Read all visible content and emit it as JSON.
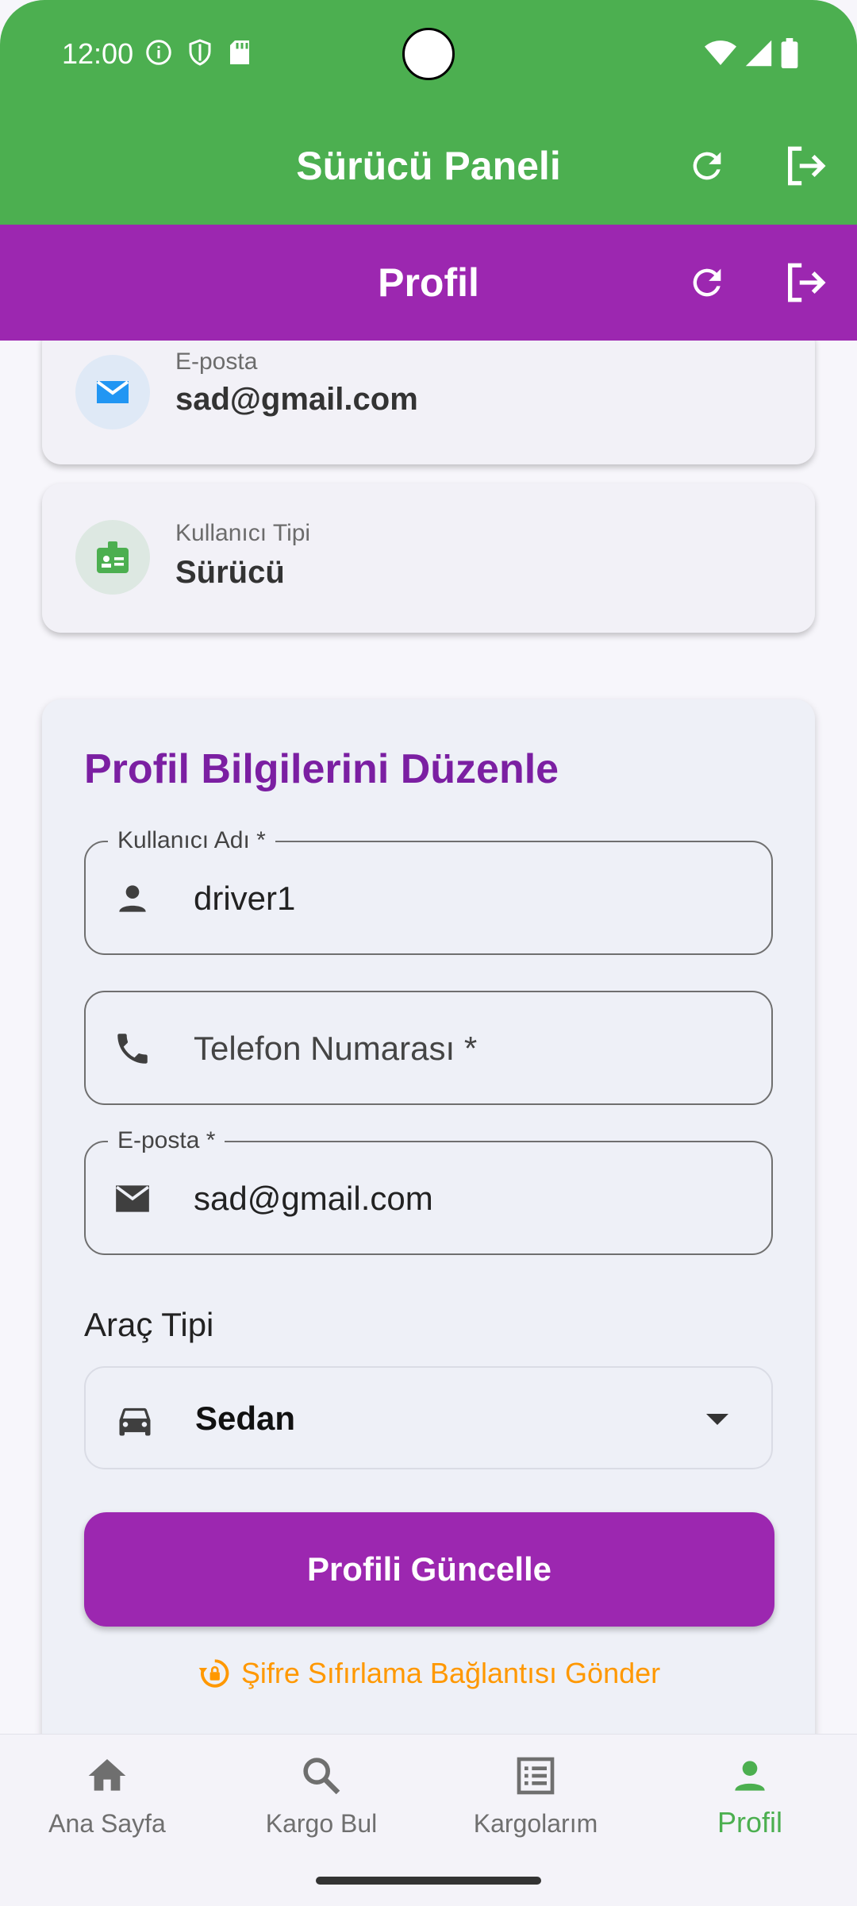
{
  "status_bar": {
    "time": "12:00"
  },
  "app_bar": {
    "title": "Sürücü Paneli",
    "refresh_icon": "refresh-icon",
    "logout_icon": "logout-icon"
  },
  "page_bar": {
    "title": "Profil",
    "refresh_icon": "refresh-icon",
    "logout_icon": "logout-icon"
  },
  "info_cards": [
    {
      "label": "E-posta",
      "value": "sad@gmail.com",
      "icon": "mail-icon",
      "color": "#2196f3"
    },
    {
      "label": "Kullanıcı Tipi",
      "value": "Sürücü",
      "icon": "badge-icon",
      "color": "#4caf50"
    }
  ],
  "edit_form": {
    "title": "Profil Bilgilerini Düzenle",
    "username": {
      "label": "Kullanıcı Adı *",
      "value": "driver1"
    },
    "phone": {
      "placeholder": "Telefon Numarası *"
    },
    "email": {
      "label": "E-posta *",
      "value": "sad@gmail.com"
    },
    "vehicle_type_label": "Araç Tipi",
    "vehicle_type": {
      "selected": "Sedan"
    },
    "submit_label": "Profili Güncelle",
    "reset_password_label": "Şifre Sıfırlama Bağlantısı Gönder"
  },
  "bottom_nav": [
    {
      "label": "Ana Sayfa",
      "icon": "home-icon",
      "active": false
    },
    {
      "label": "Kargo Bul",
      "icon": "search-icon",
      "active": false
    },
    {
      "label": "Kargolarım",
      "icon": "list-icon",
      "active": false
    },
    {
      "label": "Profil",
      "icon": "person-icon",
      "active": true
    }
  ],
  "colors": {
    "primary_green": "#4caf50",
    "primary_purple": "#9c27b0",
    "title_purple": "#7b1fa2",
    "accent_orange": "#ff9800"
  }
}
